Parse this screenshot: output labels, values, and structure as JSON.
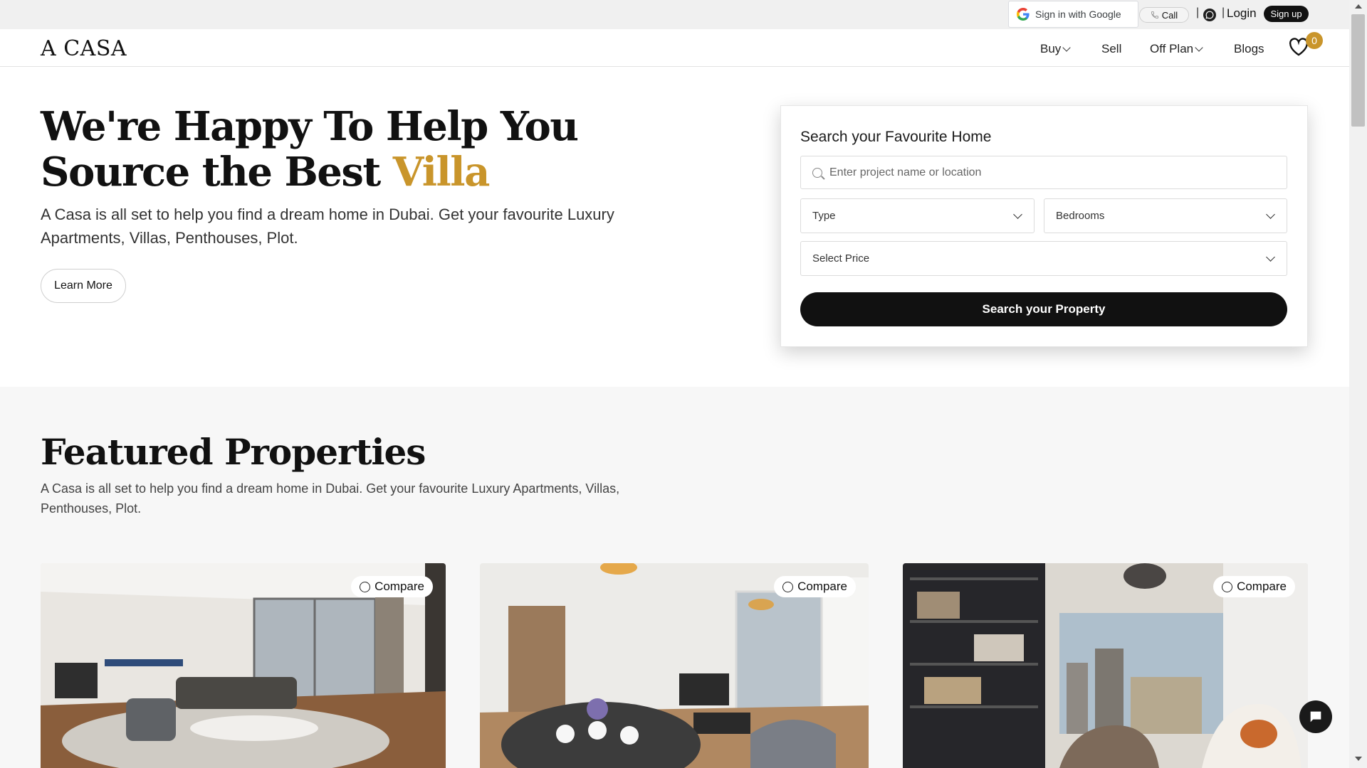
{
  "topbar": {
    "google_label": "Sign in with Google",
    "call_label": "Call",
    "login_label": "Login",
    "signup_label": "Sign up"
  },
  "nav": {
    "logo": "A CASA",
    "items": [
      {
        "label": "Buy",
        "has_dropdown": true
      },
      {
        "label": "Sell",
        "has_dropdown": false
      },
      {
        "label": "Off Plan",
        "has_dropdown": true
      },
      {
        "label": "Blogs",
        "has_dropdown": false
      }
    ],
    "wishlist_count": "0",
    "accent_color": "#c9952b"
  },
  "hero": {
    "title_main": "We're Happy To Help You Source the Best ",
    "title_accent": "Villa",
    "description": "A Casa is all set to help you find a dream home in Dubai. Get your favourite Luxury Apartments, Villas, Penthouses, Plot.",
    "learn_more_label": "Learn More"
  },
  "search": {
    "title": "Search your Favourite Home",
    "placeholder": "Enter project name or location",
    "type_label": "Type",
    "bedrooms_label": "Bedrooms",
    "price_label": "Select Price",
    "submit_label": "Search your Property"
  },
  "featured": {
    "title": "Featured Properties",
    "description": "A Casa is all set to help you find a dream home in Dubai. Get your favourite Luxury Apartments, Villas, Penthouses, Plot.",
    "cards": [
      {
        "compare_label": "Compare"
      },
      {
        "compare_label": "Compare"
      },
      {
        "compare_label": "Compare"
      }
    ]
  }
}
